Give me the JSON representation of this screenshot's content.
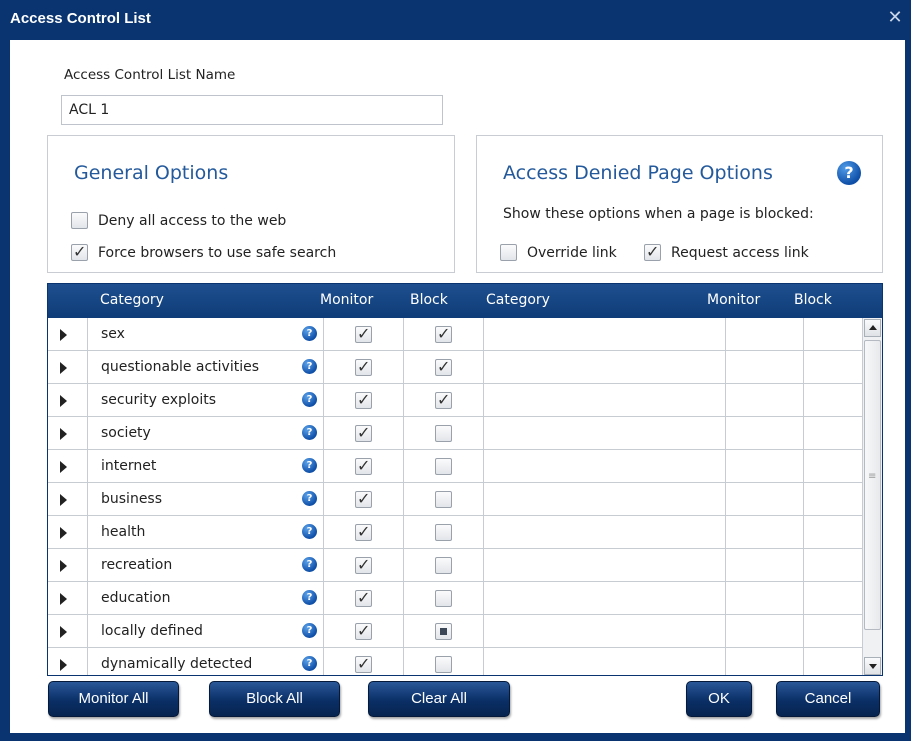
{
  "window": {
    "title": "Access Control List",
    "close_icon": "close-icon"
  },
  "acl_name": {
    "label": "Access Control List Name",
    "value": "ACL 1"
  },
  "general_options": {
    "title": "General Options",
    "options": [
      {
        "label": "Deny all access to the web",
        "checked": false
      },
      {
        "label": "Force browsers to use safe search",
        "checked": true
      }
    ]
  },
  "access_denied": {
    "title": "Access Denied Page Options",
    "help_icon": "help-icon",
    "info": "Show these options when a page is blocked:",
    "override_label": "Override link",
    "override_checked": false,
    "request_label": "Request access link",
    "request_checked": true
  },
  "table": {
    "headers": [
      "Category",
      "Monitor",
      "Block",
      "Category",
      "Monitor",
      "Block"
    ],
    "rows": [
      {
        "name": "sex",
        "monitor": "checked",
        "block": "checked"
      },
      {
        "name": "questionable activities",
        "monitor": "checked",
        "block": "checked"
      },
      {
        "name": "security exploits",
        "monitor": "checked",
        "block": "checked"
      },
      {
        "name": "society",
        "monitor": "checked",
        "block": "unchecked"
      },
      {
        "name": "internet",
        "monitor": "checked",
        "block": "unchecked"
      },
      {
        "name": "business",
        "monitor": "checked",
        "block": "unchecked"
      },
      {
        "name": "health",
        "monitor": "checked",
        "block": "unchecked"
      },
      {
        "name": "recreation",
        "monitor": "checked",
        "block": "unchecked"
      },
      {
        "name": "education",
        "monitor": "checked",
        "block": "unchecked"
      },
      {
        "name": "locally defined",
        "monitor": "checked",
        "block": "partial"
      },
      {
        "name": "dynamically detected",
        "monitor": "checked",
        "block": "unchecked"
      }
    ]
  },
  "buttons": {
    "monitor_all": "Monitor All",
    "block_all": "Block All",
    "clear_all": "Clear All",
    "ok": "OK",
    "cancel": "Cancel"
  },
  "colors": {
    "titlebar": "#0a3470",
    "header": "#0e3c78",
    "panel_title": "#245a9c",
    "help_icon": "#0f4fa8"
  }
}
